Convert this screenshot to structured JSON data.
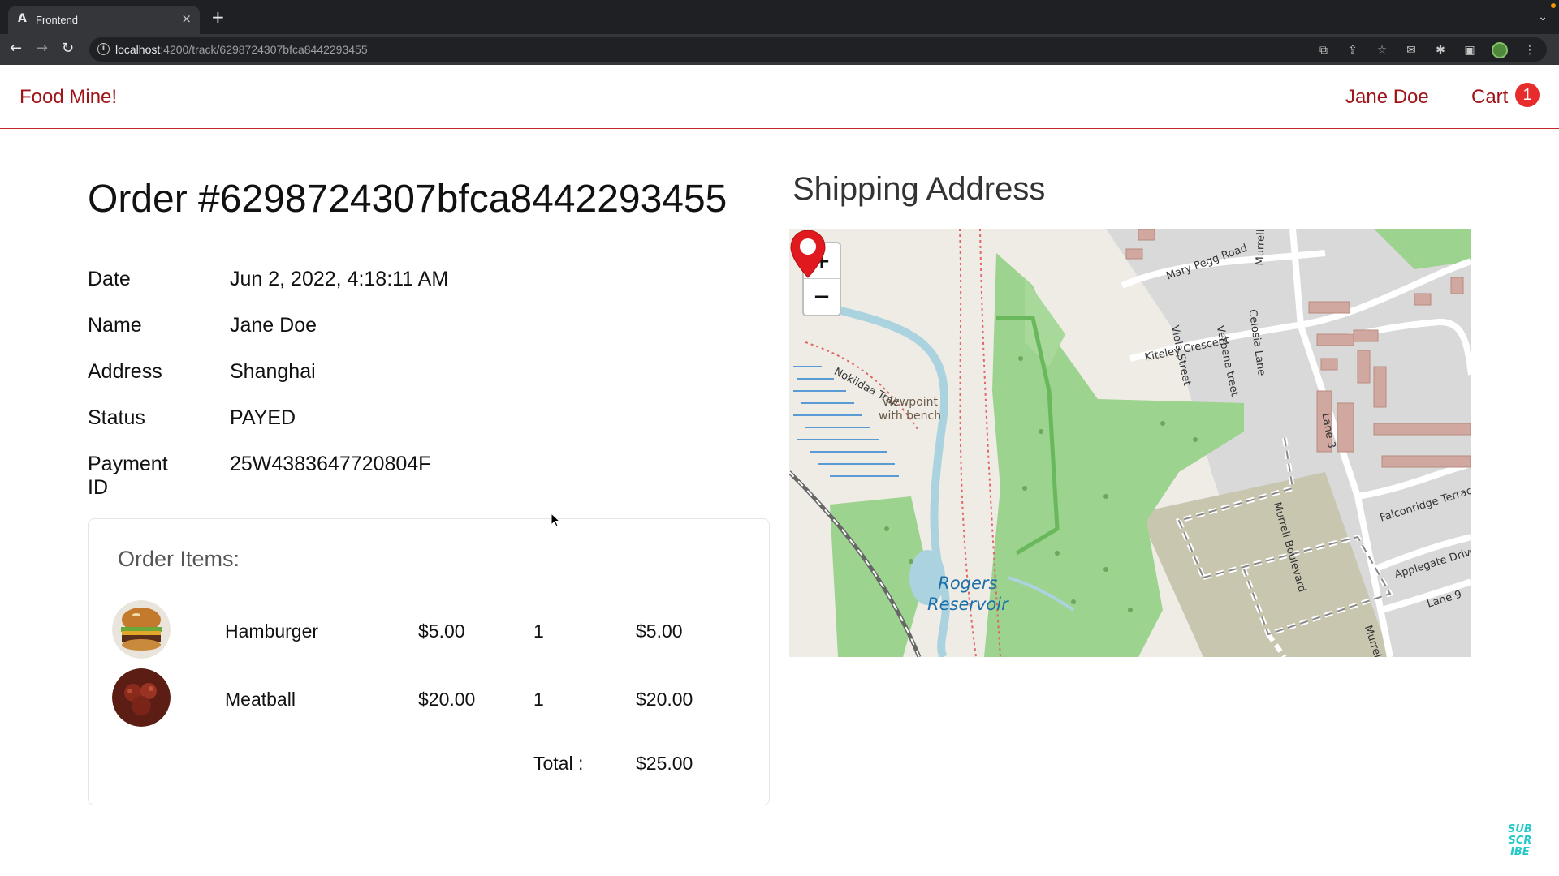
{
  "browser": {
    "tab_title": "Frontend",
    "tab_favicon": "A",
    "url_host": "localhost",
    "url_path": ":4200/track/6298724307bfca8442293455"
  },
  "header": {
    "logo": "Food Mine!",
    "user_name": "Jane Doe",
    "cart_label": "Cart",
    "cart_count": "1"
  },
  "order": {
    "title": "Order #6298724307bfca8442293455",
    "details": [
      {
        "label": "Date",
        "value": "Jun 2, 2022, 4:18:11 AM"
      },
      {
        "label": "Name",
        "value": "Jane Doe"
      },
      {
        "label": "Address",
        "value": "Shanghai"
      },
      {
        "label": "Status",
        "value": "PAYED"
      },
      {
        "label": "Payment ID",
        "value": "25W4383647720804F"
      }
    ],
    "items_title": "Order Items:",
    "items": [
      {
        "name": "Hamburger",
        "price": "$5.00",
        "quantity": "1",
        "total": "$5.00",
        "image_icon": "hamburger-image"
      },
      {
        "name": "Meatball",
        "price": "$20.00",
        "quantity": "1",
        "total": "$20.00",
        "image_icon": "meatball-image"
      }
    ],
    "total_label": "Total :",
    "total_value": "$25.00"
  },
  "shipping": {
    "title": "Shipping Address",
    "zoom_in": "+",
    "zoom_out": "−",
    "labels": {
      "mary_pegg": "Mary Pegg Road",
      "viola": "Viola Street",
      "verbena": "Verbena treet",
      "celosia": "Celosia Lane",
      "murrell_top": "Murrell Boule",
      "kiteley": "Kiteley Crescent",
      "nokiidaa": "Nokiidaa Trail",
      "viewpoint": "Viewpoint\nwith bench",
      "lane3": "Lane 3",
      "murrell_blvd": "Murrell Boulevard",
      "falconridge": "Falconridge Terrac",
      "applegate": "Applegate Drive",
      "lane9": "Lane 9",
      "murrell_bottom": "Murrell Boul",
      "rogers": "Rogers\nReservoir"
    }
  },
  "overlay": {
    "subscribe": "SUB\nSCR\nIBE"
  },
  "colors": {
    "brand": "#a01418",
    "badge": "#e72c2c",
    "marker": "#e0191f",
    "park": "#9cd38e",
    "water": "#aad3df"
  }
}
